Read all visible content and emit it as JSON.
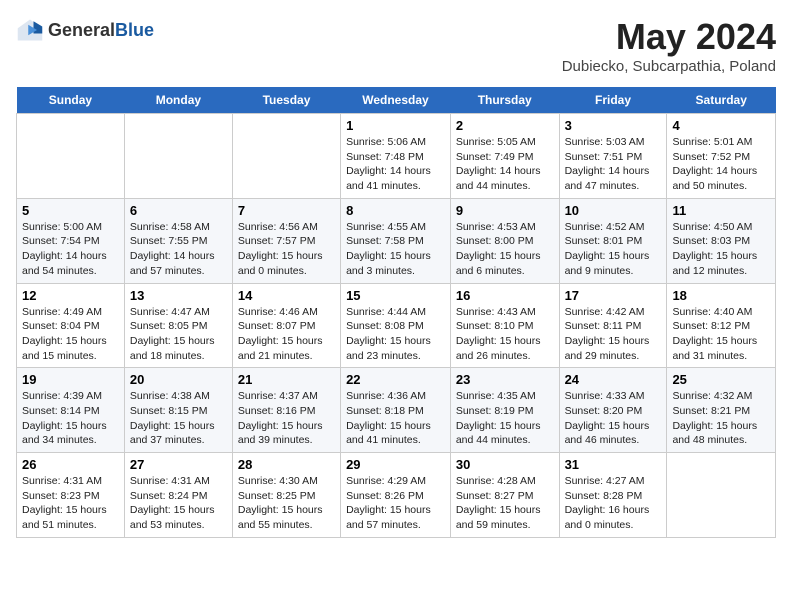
{
  "header": {
    "logo_general": "General",
    "logo_blue": "Blue",
    "title": "May 2024",
    "location": "Dubiecko, Subcarpathia, Poland"
  },
  "weekdays": [
    "Sunday",
    "Monday",
    "Tuesday",
    "Wednesday",
    "Thursday",
    "Friday",
    "Saturday"
  ],
  "weeks": [
    [
      {
        "date": "",
        "content": ""
      },
      {
        "date": "",
        "content": ""
      },
      {
        "date": "",
        "content": ""
      },
      {
        "date": "1",
        "content": "Sunrise: 5:06 AM\nSunset: 7:48 PM\nDaylight: 14 hours\nand 41 minutes."
      },
      {
        "date": "2",
        "content": "Sunrise: 5:05 AM\nSunset: 7:49 PM\nDaylight: 14 hours\nand 44 minutes."
      },
      {
        "date": "3",
        "content": "Sunrise: 5:03 AM\nSunset: 7:51 PM\nDaylight: 14 hours\nand 47 minutes."
      },
      {
        "date": "4",
        "content": "Sunrise: 5:01 AM\nSunset: 7:52 PM\nDaylight: 14 hours\nand 50 minutes."
      }
    ],
    [
      {
        "date": "5",
        "content": "Sunrise: 5:00 AM\nSunset: 7:54 PM\nDaylight: 14 hours\nand 54 minutes."
      },
      {
        "date": "6",
        "content": "Sunrise: 4:58 AM\nSunset: 7:55 PM\nDaylight: 14 hours\nand 57 minutes."
      },
      {
        "date": "7",
        "content": "Sunrise: 4:56 AM\nSunset: 7:57 PM\nDaylight: 15 hours\nand 0 minutes."
      },
      {
        "date": "8",
        "content": "Sunrise: 4:55 AM\nSunset: 7:58 PM\nDaylight: 15 hours\nand 3 minutes."
      },
      {
        "date": "9",
        "content": "Sunrise: 4:53 AM\nSunset: 8:00 PM\nDaylight: 15 hours\nand 6 minutes."
      },
      {
        "date": "10",
        "content": "Sunrise: 4:52 AM\nSunset: 8:01 PM\nDaylight: 15 hours\nand 9 minutes."
      },
      {
        "date": "11",
        "content": "Sunrise: 4:50 AM\nSunset: 8:03 PM\nDaylight: 15 hours\nand 12 minutes."
      }
    ],
    [
      {
        "date": "12",
        "content": "Sunrise: 4:49 AM\nSunset: 8:04 PM\nDaylight: 15 hours\nand 15 minutes."
      },
      {
        "date": "13",
        "content": "Sunrise: 4:47 AM\nSunset: 8:05 PM\nDaylight: 15 hours\nand 18 minutes."
      },
      {
        "date": "14",
        "content": "Sunrise: 4:46 AM\nSunset: 8:07 PM\nDaylight: 15 hours\nand 21 minutes."
      },
      {
        "date": "15",
        "content": "Sunrise: 4:44 AM\nSunset: 8:08 PM\nDaylight: 15 hours\nand 23 minutes."
      },
      {
        "date": "16",
        "content": "Sunrise: 4:43 AM\nSunset: 8:10 PM\nDaylight: 15 hours\nand 26 minutes."
      },
      {
        "date": "17",
        "content": "Sunrise: 4:42 AM\nSunset: 8:11 PM\nDaylight: 15 hours\nand 29 minutes."
      },
      {
        "date": "18",
        "content": "Sunrise: 4:40 AM\nSunset: 8:12 PM\nDaylight: 15 hours\nand 31 minutes."
      }
    ],
    [
      {
        "date": "19",
        "content": "Sunrise: 4:39 AM\nSunset: 8:14 PM\nDaylight: 15 hours\nand 34 minutes."
      },
      {
        "date": "20",
        "content": "Sunrise: 4:38 AM\nSunset: 8:15 PM\nDaylight: 15 hours\nand 37 minutes."
      },
      {
        "date": "21",
        "content": "Sunrise: 4:37 AM\nSunset: 8:16 PM\nDaylight: 15 hours\nand 39 minutes."
      },
      {
        "date": "22",
        "content": "Sunrise: 4:36 AM\nSunset: 8:18 PM\nDaylight: 15 hours\nand 41 minutes."
      },
      {
        "date": "23",
        "content": "Sunrise: 4:35 AM\nSunset: 8:19 PM\nDaylight: 15 hours\nand 44 minutes."
      },
      {
        "date": "24",
        "content": "Sunrise: 4:33 AM\nSunset: 8:20 PM\nDaylight: 15 hours\nand 46 minutes."
      },
      {
        "date": "25",
        "content": "Sunrise: 4:32 AM\nSunset: 8:21 PM\nDaylight: 15 hours\nand 48 minutes."
      }
    ],
    [
      {
        "date": "26",
        "content": "Sunrise: 4:31 AM\nSunset: 8:23 PM\nDaylight: 15 hours\nand 51 minutes."
      },
      {
        "date": "27",
        "content": "Sunrise: 4:31 AM\nSunset: 8:24 PM\nDaylight: 15 hours\nand 53 minutes."
      },
      {
        "date": "28",
        "content": "Sunrise: 4:30 AM\nSunset: 8:25 PM\nDaylight: 15 hours\nand 55 minutes."
      },
      {
        "date": "29",
        "content": "Sunrise: 4:29 AM\nSunset: 8:26 PM\nDaylight: 15 hours\nand 57 minutes."
      },
      {
        "date": "30",
        "content": "Sunrise: 4:28 AM\nSunset: 8:27 PM\nDaylight: 15 hours\nand 59 minutes."
      },
      {
        "date": "31",
        "content": "Sunrise: 4:27 AM\nSunset: 8:28 PM\nDaylight: 16 hours\nand 0 minutes."
      },
      {
        "date": "",
        "content": ""
      }
    ]
  ]
}
